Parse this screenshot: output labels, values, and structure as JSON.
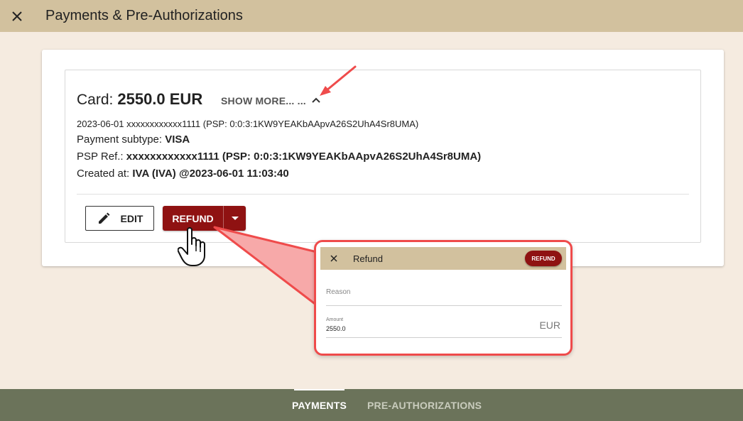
{
  "appbar": {
    "title": "Payments & Pre-Authorizations",
    "close_icon": "close-icon"
  },
  "payment": {
    "amount_label": "Card:",
    "amount_value": "2550.0 EUR",
    "show_more": "SHOW MORE... ...",
    "summary_line": "2023-06-01 xxxxxxxxxxxx1111 (PSP: 0:0:3:1KW9YEAKbAApvA26S2UhA4Sr8UMA)",
    "subtype_label": "Payment subtype: ",
    "subtype_value": "VISA",
    "psp_label": "PSP Ref.: ",
    "psp_value": "xxxxxxxxxxxx1111 (PSP: 0:0:3:1KW9YEAKbAApvA26S2UhA4Sr8UMA)",
    "created_label": "Created at: ",
    "created_value": "IVA (IVA) @2023-06-01 11:03:40"
  },
  "actions": {
    "edit_label": "EDIT",
    "refund_label": "REFUND"
  },
  "refund_dialog": {
    "title": "Refund",
    "submit_label": "REFUND",
    "reason_placeholder": "Reason",
    "amount_label": "Amount",
    "amount_value": "2550.0",
    "currency": "EUR"
  },
  "tabs": {
    "payments": "PAYMENTS",
    "pre_authorizations": "PRE-AUTHORIZATIONS"
  },
  "colors": {
    "appbar": "#d2c19e",
    "background": "#f5ebe0",
    "primary": "#8f1212",
    "bottombar": "#6b735a",
    "annotation": "#ef4b4b"
  }
}
